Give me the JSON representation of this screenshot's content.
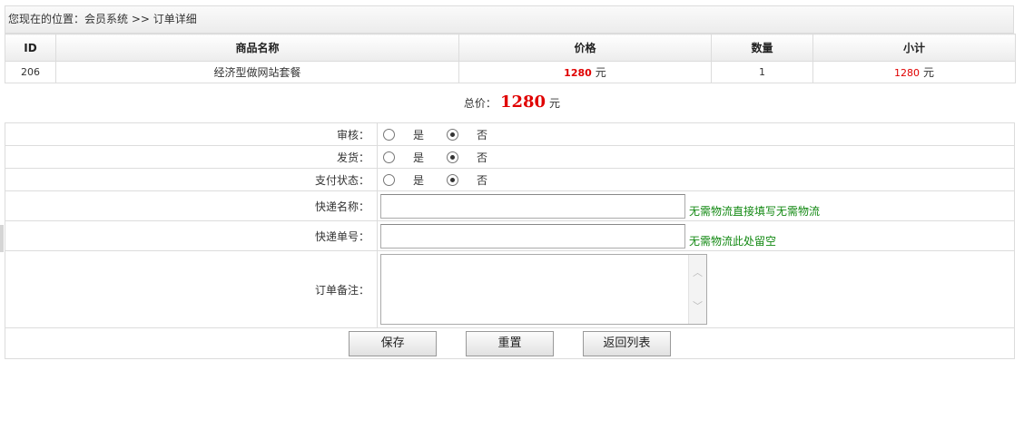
{
  "breadcrumb": {
    "prefix": "您现在的位置：",
    "section": "会员系统",
    "separator": ">>",
    "current": "订单详细"
  },
  "goods_table": {
    "headers": [
      "ID",
      "商品名称",
      "价格",
      "数量",
      "小计"
    ],
    "rows": [
      {
        "id": "206",
        "name": "经济型做网站套餐",
        "price": "1280",
        "price_unit": "元",
        "qty": "1",
        "subtotal": "1280",
        "subtotal_unit": "元"
      }
    ]
  },
  "total": {
    "label": "总价：",
    "value": "1280",
    "unit": "元"
  },
  "form": {
    "audit": {
      "label": "审核：",
      "options": [
        "是",
        "否"
      ],
      "selected": "否"
    },
    "shipped": {
      "label": "发货：",
      "options": [
        "是",
        "否"
      ],
      "selected": "否"
    },
    "pay_status": {
      "label": "支付状态：",
      "options": [
        "是",
        "否"
      ],
      "selected": "否"
    },
    "courier_name": {
      "label": "快递名称：",
      "value": "",
      "hint": "无需物流直接填写无需物流"
    },
    "tracking_no": {
      "label": "快递单号：",
      "value": "",
      "hint": "无需物流此处留空"
    },
    "remark": {
      "label": "订单备注：",
      "value": ""
    }
  },
  "buttons": {
    "save": "保存",
    "reset": "重置",
    "back": "返回列表"
  },
  "colors": {
    "price": "#e00000",
    "hint": "#118811",
    "border": "#dcdcdc"
  }
}
